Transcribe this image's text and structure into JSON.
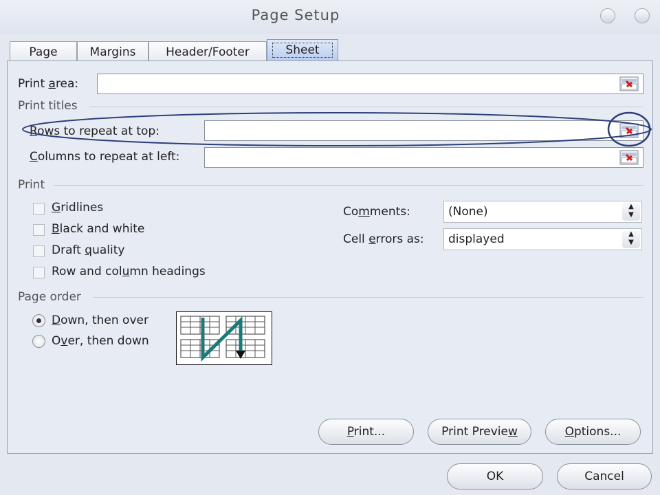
{
  "window": {
    "title": "Page Setup"
  },
  "tabs": [
    "Page",
    "Margins",
    "Header/Footer",
    "Sheet"
  ],
  "active_tab": "Sheet",
  "print_area": {
    "label_pre": "Print ",
    "label_u": "a",
    "label_post": "rea:",
    "value": ""
  },
  "print_titles": {
    "group_label": "Print titles",
    "rows_label_u": "R",
    "rows_label_rest": "ows to repeat at top:",
    "rows_value": "",
    "cols_label_u": "C",
    "cols_label_rest": "olumns to repeat at left:",
    "cols_value": ""
  },
  "print": {
    "group_label": "Print",
    "gridlines_u": "G",
    "gridlines_rest": "ridlines",
    "bw_u": "B",
    "bw_rest": "lack and white",
    "draft_pre": "Draft ",
    "draft_u": "q",
    "draft_rest": "uality",
    "headings_pre": "Row and col",
    "headings_u": "u",
    "headings_rest": "mn headings",
    "comments_pre": "Co",
    "comments_u": "m",
    "comments_rest": "ments:",
    "comments_value": "(None)",
    "errors_pre": "Cell ",
    "errors_u": "e",
    "errors_rest": "rrors as:",
    "errors_value": "displayed"
  },
  "page_order": {
    "group_label": "Page order",
    "down_u": "D",
    "down_rest": "own, then over",
    "over_pre": "O",
    "over_u": "v",
    "over_rest": "er, then down",
    "selected": "Down, then over"
  },
  "buttons": {
    "print_u": "P",
    "print_rest": "rint...",
    "preview_pre": "Print Previe",
    "preview_u": "w",
    "options_u": "O",
    "options_rest": "ptions...",
    "ok": "OK",
    "cancel": "Cancel"
  }
}
